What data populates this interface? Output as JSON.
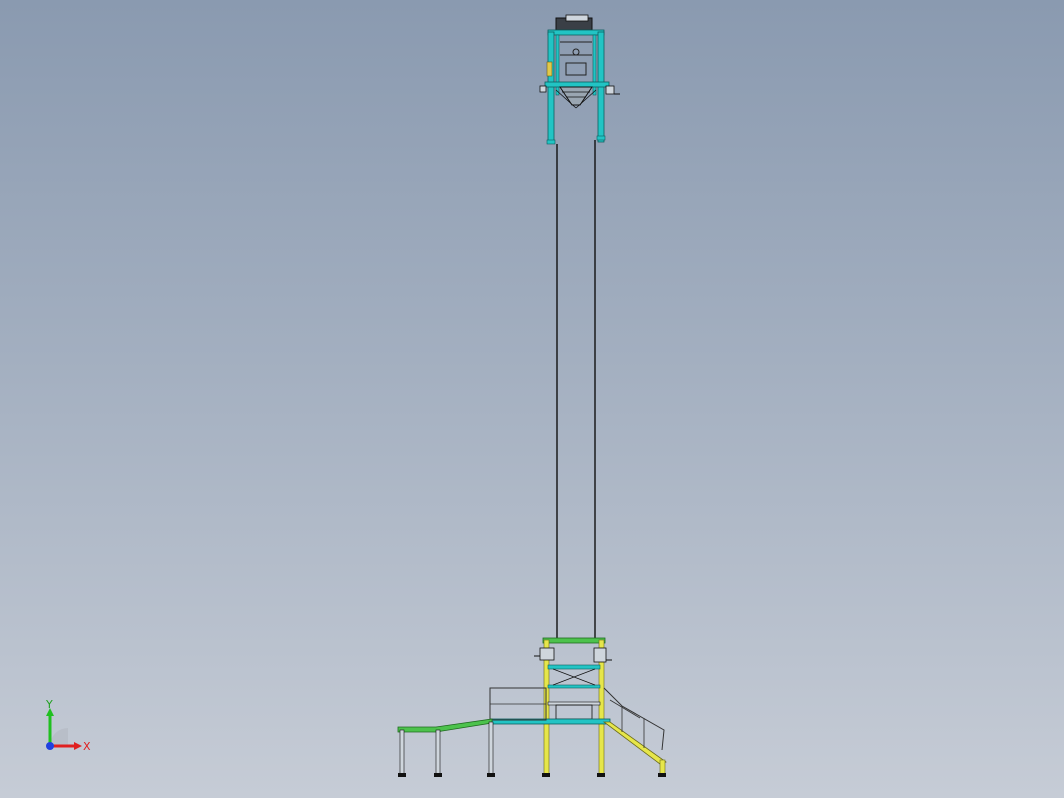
{
  "viewport": {
    "background_top": "#8a9ab0",
    "background_bottom": "#c6ccd6"
  },
  "model": {
    "frame_color": "#22c4c4",
    "rail_color": "#111111",
    "platform_color": "#4cc24c",
    "stair_color": "#e6e64a",
    "accent_yellow": "#e1c84a"
  },
  "triad": {
    "x_label": "X",
    "y_label": "Y",
    "x_color": "#e02020",
    "y_color": "#20c020",
    "z_color": "#2040e0"
  }
}
